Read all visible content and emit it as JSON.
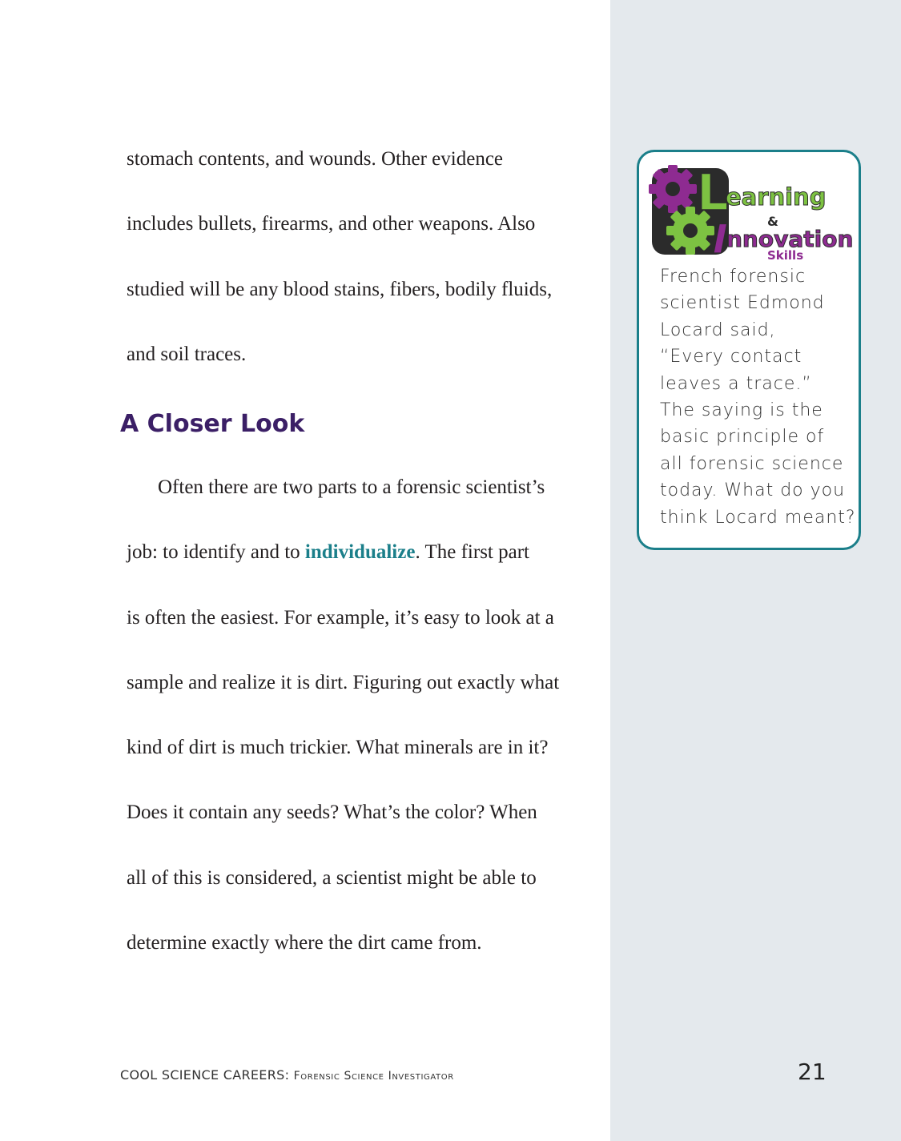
{
  "body_lines_top": [
    "stomach contents, and wounds. Other evidence",
    "includes bullets, firearms, and other weapons. Also",
    "studied will be any blood stains, fibers, bodily fluids,",
    "and soil traces."
  ],
  "section_heading": "A Closer Look",
  "paragraph": {
    "line1": "Often there are two parts to a forensic scientist’s",
    "line2_before": "job: to identify and to ",
    "line2_keyword": "individualize",
    "line2_after": ". The first part",
    "lines_rest": [
      "is often the easiest. For example, it’s easy to look at a",
      "sample and realize it is dirt. Figuring out exactly what",
      "kind of dirt is much trickier. What minerals are in it?",
      "Does it contain any seeds? What’s the color? When",
      "all of this is considered, a scientist might be able to",
      "determine exactly where the dirt came from."
    ]
  },
  "callout": {
    "logo": {
      "letter_l": "L",
      "word1": "earning",
      "ampersand": "&",
      "letter_i": "I",
      "word2": "nnovation",
      "word3": "Skills"
    },
    "lines": [
      "French forensic",
      "scientist Edmond",
      "Locard said,",
      "“Every contact",
      "leaves a trace.”",
      "The saying is the",
      "basic principle of",
      "all forensic science",
      "today. What do you",
      "think Locard meant?"
    ]
  },
  "footer": {
    "series": "COOL SCIENCE CAREERS: ",
    "book_title": "Forensic Science Investigator",
    "page_number": "21"
  },
  "colors": {
    "sidebar_bg": "#e4e9ed",
    "heading": "#3b1f66",
    "keyword": "#1b7f8a",
    "callout_border": "#1b7f8a",
    "logo_green": "#7dc242",
    "logo_purple": "#8e2b91"
  }
}
